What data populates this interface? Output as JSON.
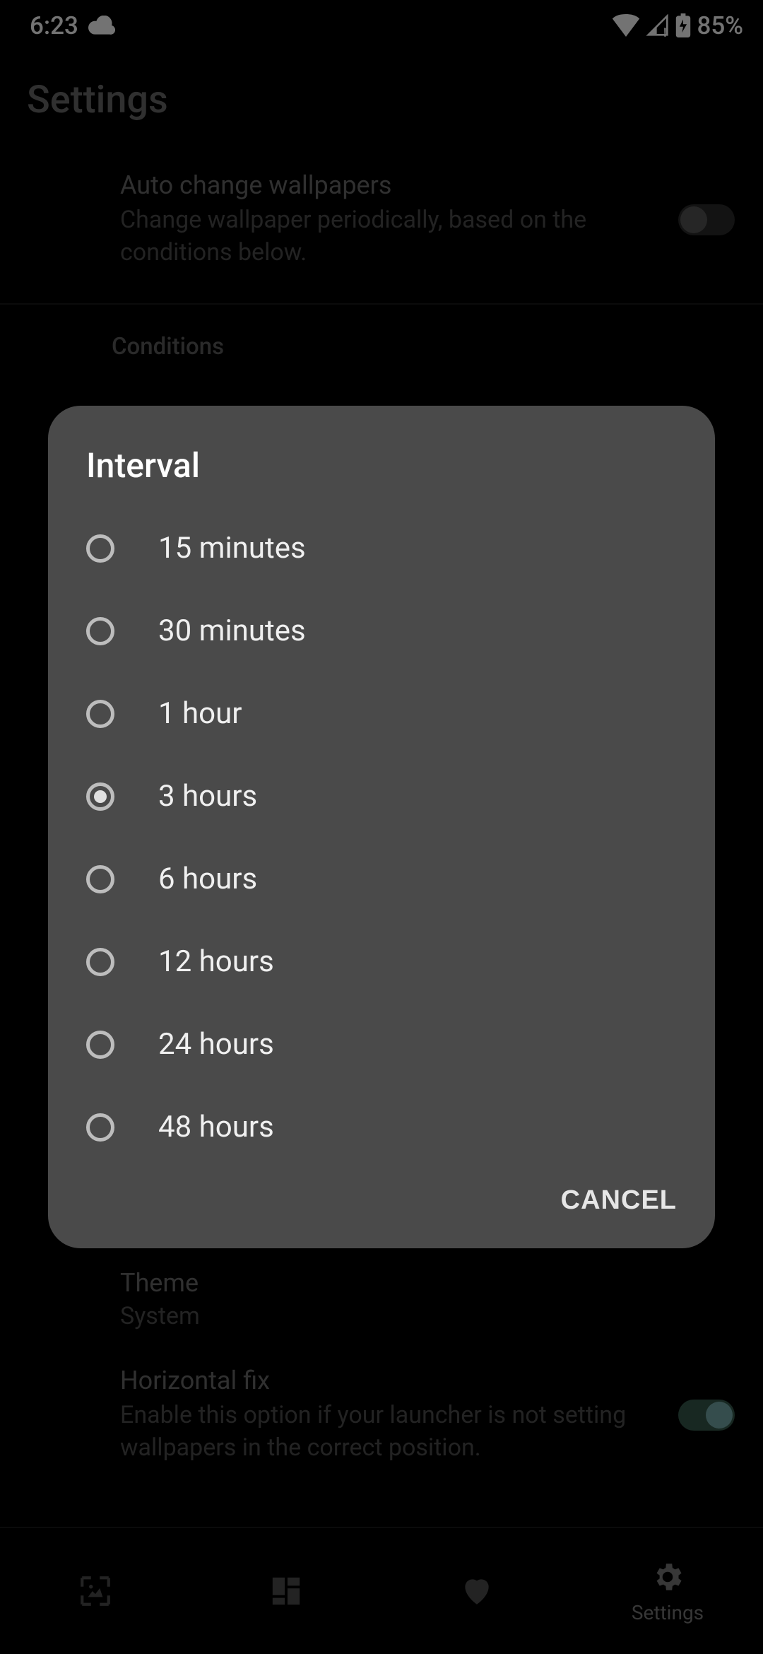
{
  "status": {
    "time": "6:23",
    "battery": "85%"
  },
  "page": {
    "title": "Settings"
  },
  "auto_change": {
    "title": "Auto change wallpapers",
    "subtitle": "Change wallpaper periodically, based on the conditions below."
  },
  "conditions_header": "Conditions",
  "theme_row": {
    "title": "Theme",
    "value": "System"
  },
  "horizontal_fix": {
    "title": "Horizontal fix",
    "subtitle": "Enable this option if your launcher is not setting wallpapers in the correct position."
  },
  "nav": {
    "settings_label": "Settings"
  },
  "dialog": {
    "title": "Interval",
    "options": [
      "15 minutes",
      "30 minutes",
      "1 hour",
      "3 hours",
      "6 hours",
      "12 hours",
      "24 hours",
      "48 hours"
    ],
    "selected_index": 3,
    "cancel": "CANCEL"
  }
}
